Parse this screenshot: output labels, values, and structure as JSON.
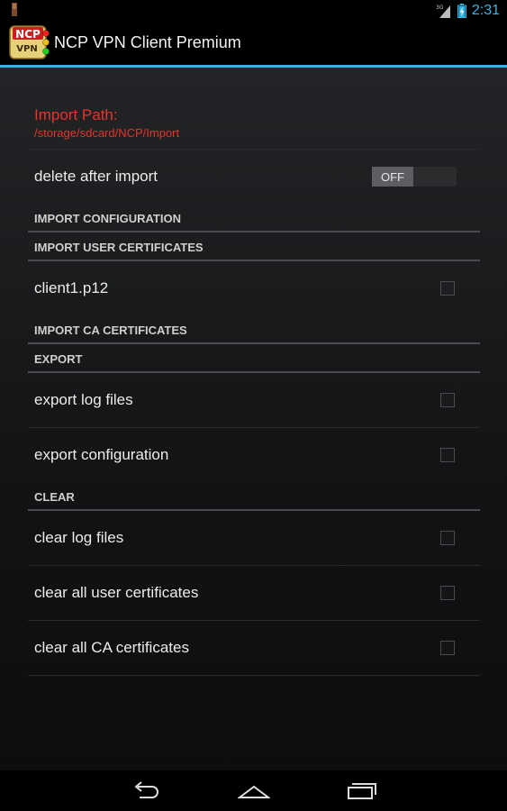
{
  "status_bar": {
    "network": "3G",
    "time": "2:31"
  },
  "action_bar": {
    "logo_text_top": "NCP",
    "logo_text_bottom": "VPN",
    "title": "NCP VPN Client Premium"
  },
  "import_path": {
    "title": "Import Path:",
    "path": "/storage/sdcard/NCP/Import"
  },
  "delete_after_import": {
    "label": "delete after import",
    "toggle_state": "OFF"
  },
  "sections": {
    "import_configuration": "IMPORT CONFIGURATION",
    "import_user_certificates": "IMPORT USER CERTIFICATES",
    "import_ca_certificates": "IMPORT CA CERTIFICATES",
    "export": "EXPORT",
    "clear": "CLEAR"
  },
  "user_certificates": [
    {
      "label": "client1.p12",
      "checked": false
    }
  ],
  "export_items": [
    {
      "label": "export log files",
      "checked": false
    },
    {
      "label": "export configuration",
      "checked": false
    }
  ],
  "clear_items": [
    {
      "label": "clear log files",
      "checked": false
    },
    {
      "label": "clear all user certificates",
      "checked": false
    },
    {
      "label": "clear all CA certificates",
      "checked": false
    }
  ],
  "colors": {
    "accent": "#33b5e5",
    "error_text": "#e8332b"
  },
  "icons": {
    "status": [
      "usb-debug-icon",
      "signal-3g-icon",
      "battery-charging-icon"
    ],
    "nav": [
      "back-icon",
      "home-icon",
      "recent-apps-icon"
    ]
  }
}
